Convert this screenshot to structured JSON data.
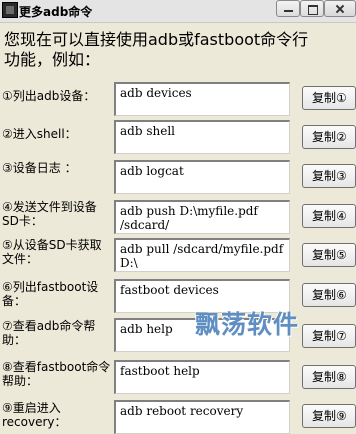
{
  "window": {
    "title": "更多adb命令",
    "icon": "app-icon",
    "controls": [
      "minimize-icon",
      "maximize-icon",
      "close-icon"
    ]
  },
  "intro": "您现在可以直接使用adb或fastboot命令行功能，例如：",
  "rows": [
    {
      "label": "①列出adb设备：",
      "command": "adb devices",
      "button": "复制①"
    },
    {
      "label": "②进入shell：",
      "command": "adb shell",
      "button": "复制②"
    },
    {
      "label": "③设备日志 ：",
      "command": "adb logcat",
      "button": "复制③"
    },
    {
      "label": "④发送文件到设备SD卡：",
      "command": "adb push D:\\myfile.pdf /sdcard/",
      "button": "复制④"
    },
    {
      "label": "⑤从设备SD卡获取文件：",
      "command": "adb pull /sdcard/myfile.pdf D:\\",
      "button": "复制⑤"
    },
    {
      "label": "⑥列出fastboot设备：",
      "command": "fastboot devices",
      "button": "复制⑥"
    },
    {
      "label": "⑦查看adb命令帮助：",
      "command": "adb help",
      "button": "复制⑦"
    },
    {
      "label": "⑧查看fastboot命令帮助：",
      "command": "fastboot help",
      "button": "复制⑧"
    },
    {
      "label": "⑨重启进入recovery：",
      "command": "adb reboot recovery",
      "button": "复制⑨"
    }
  ],
  "watermark": "飘荡软件"
}
